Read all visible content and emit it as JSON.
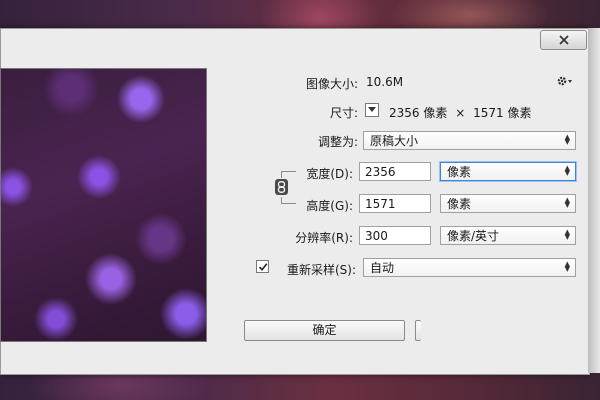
{
  "image_size": {
    "label": "图像大小:",
    "value": "10.6M"
  },
  "dimensions": {
    "label": "尺寸:",
    "width": "2356",
    "width_unit": "像素",
    "times": "×",
    "height": "1571",
    "height_unit": "像素"
  },
  "fit_to": {
    "label": "调整为:",
    "selected": "原稿大小"
  },
  "width_field": {
    "label": "宽度(D):",
    "value": "2356",
    "unit": "像素"
  },
  "height_field": {
    "label": "高度(G):",
    "value": "1571",
    "unit": "像素"
  },
  "resolution": {
    "label": "分辨率(R):",
    "value": "300",
    "unit": "像素/英寸"
  },
  "resample": {
    "label": "重新采样(S):",
    "checked": true,
    "selected": "自动"
  },
  "buttons": {
    "ok": "确定"
  },
  "colors": {
    "dialog_bg": "#ececec",
    "focus_blue": "#3c84d8"
  },
  "icons": [
    "gear-icon",
    "close-icon",
    "chain-link-icon",
    "checkmark-icon",
    "dropdown-arrow-icon"
  ]
}
